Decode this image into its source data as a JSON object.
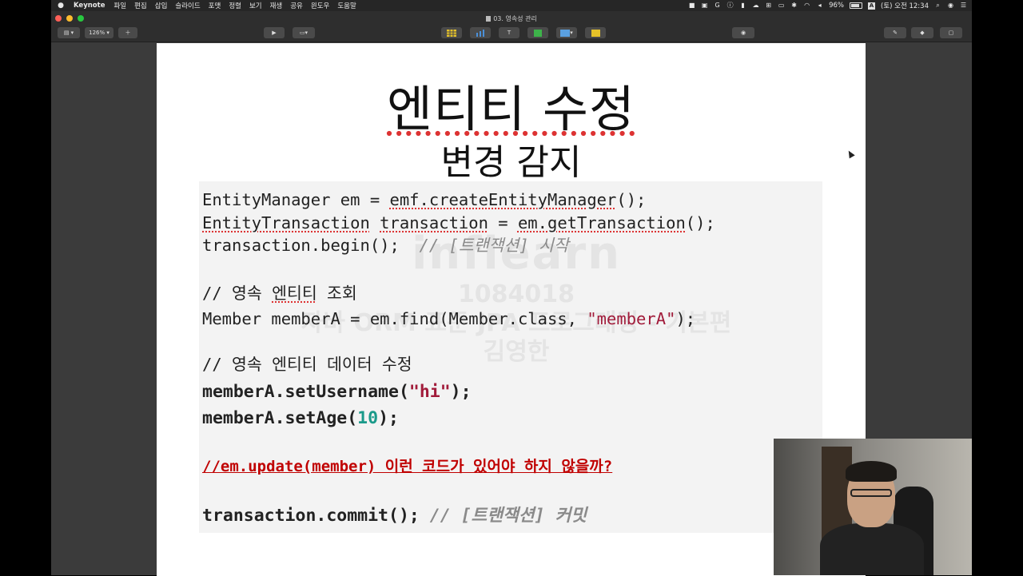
{
  "menubar": {
    "app_name": "Keynote",
    "items": [
      "파일",
      "편집",
      "삽입",
      "슬라이드",
      "포맷",
      "정렬",
      "보기",
      "재생",
      "공유",
      "윈도우",
      "도움말"
    ],
    "battery": "96%",
    "clock": "(토) 오전 12:34",
    "input_source": "A"
  },
  "window": {
    "title": "03. 영속성 관리"
  },
  "toolbar": {
    "zoom": "126%"
  },
  "slide": {
    "title": "엔티티 수정",
    "subtitle": "변경 감지",
    "code": {
      "line1_plain": "EntityManager em = ",
      "line1_call": "emf.createEntityManager",
      "line1_end": "();",
      "line2_type": "EntityTransaction",
      "line2_mid": " ",
      "line2_var": "transaction",
      "line2_eq": " = ",
      "line2_call": "em.getTransaction",
      "line2_end": "();",
      "line3_code": "transaction.begin();  ",
      "line3_comment": "// [트랜잭션] 시작",
      "line4_comment_prefix": "// 영속 ",
      "line4_comment_word": "엔티티",
      "line4_comment_suffix": " 조회",
      "line5_code": "Member memberA = em.find(Member.class, ",
      "line5_str": "\"memberA\"",
      "line5_end": ");",
      "line6_comment": "// 영속 엔티티 데이터 수정",
      "line7_code": "memberA.setUsername(",
      "line7_str": "\"hi\"",
      "line7_end": ");",
      "line8_code": "memberA.setAge(",
      "line8_num": "10",
      "line8_end": ");",
      "line9_question": "//em.update(member) 이런 코드가 있어야 하지 않을까?",
      "line10_code": "transaction.commit(); ",
      "line10_comment": "// [트랜잭션] 커밋"
    },
    "watermark": {
      "logo": "inflearn",
      "id": "1084018",
      "course": "자바 ORM 표준 JPA 프로그래밍 - 기본편",
      "author": "김영한"
    }
  }
}
